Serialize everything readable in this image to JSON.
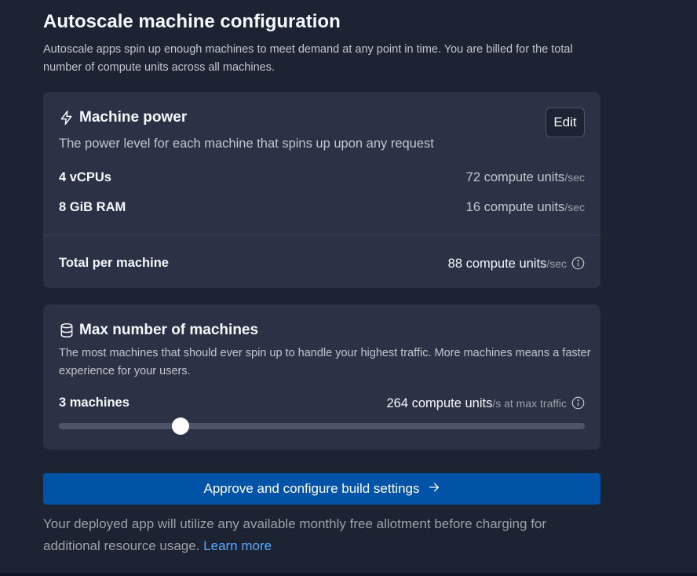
{
  "header": {
    "title": "Autoscale machine configuration",
    "subtitle": "Autoscale apps spin up enough machines to meet demand at any point in time. You are billed for the total number of compute units across all machines."
  },
  "machine_power": {
    "icon": "lightning-icon",
    "title": "Machine power",
    "edit_label": "Edit",
    "description": "The power level for each machine that spins up upon any request",
    "rows": [
      {
        "label": "4 vCPUs",
        "value": "72 compute units",
        "unit": "/sec"
      },
      {
        "label": "8 GiB RAM",
        "value": "16 compute units",
        "unit": "/sec"
      }
    ],
    "total": {
      "label": "Total per machine",
      "value": "88 compute units",
      "unit": "/sec"
    }
  },
  "max_machines": {
    "icon": "database-icon",
    "title": "Max number of machines",
    "description": "The most machines that should ever spin up to handle your highest traffic. More machines means a faster experience for your users.",
    "count_label": "3 machines",
    "value": "264 compute units",
    "unit": "/s at max traffic",
    "slider_fraction": 0.231
  },
  "approve_button": {
    "label": "Approve and configure build settings",
    "icon": "arrow-right-icon"
  },
  "note": {
    "text": "Your deployed app will utilize any available monthly free allotment before charging for additional resource usage.",
    "link": "Learn more"
  },
  "colors": {
    "background": "#1c2333",
    "card": "#2b3245",
    "primary_button": "#0053a6",
    "link": "#57abff"
  }
}
